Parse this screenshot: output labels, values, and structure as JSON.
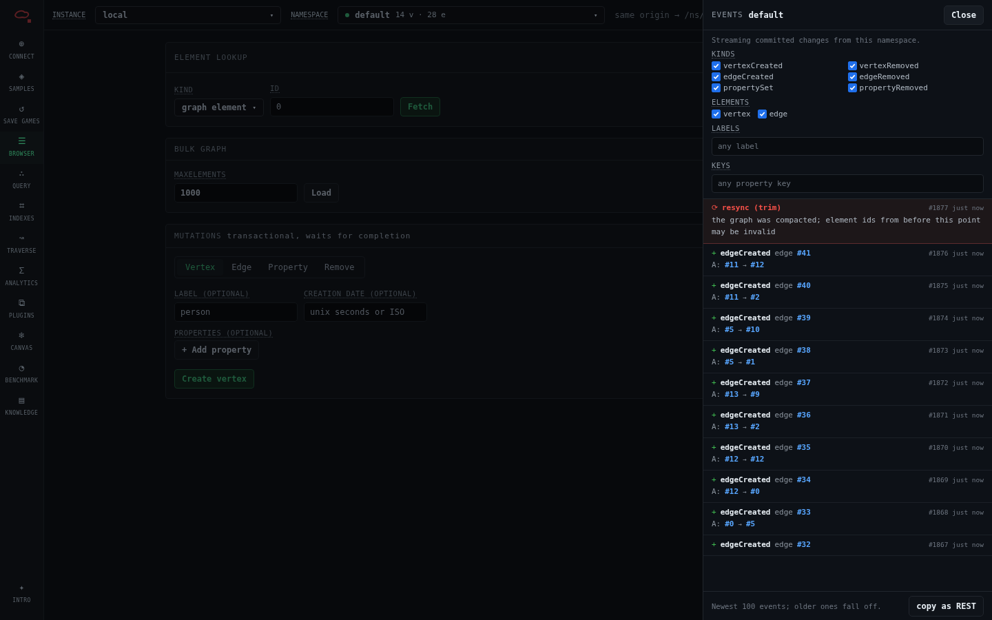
{
  "sidebar": {
    "items": [
      {
        "icon": "⊕",
        "label": "CONNECT",
        "selected": false
      },
      {
        "icon": "◈",
        "label": "SAMPLES",
        "selected": false
      },
      {
        "icon": "↺",
        "label": "SAVE GAMES",
        "selected": false
      },
      {
        "icon": "☰",
        "label": "BROWSER",
        "selected": true
      },
      {
        "icon": "∴",
        "label": "QUERY",
        "selected": false
      },
      {
        "icon": "⌗",
        "label": "INDEXES",
        "selected": false
      },
      {
        "icon": "↝",
        "label": "TRAVERSE",
        "selected": false
      },
      {
        "icon": "Σ",
        "label": "ANALYTICS",
        "selected": false
      },
      {
        "icon": "⧉",
        "label": "PLUGINS",
        "selected": false
      },
      {
        "icon": "❄",
        "label": "CANVAS",
        "selected": false
      },
      {
        "icon": "◔",
        "label": "BENCHMARK",
        "selected": false
      },
      {
        "icon": "▤",
        "label": "KNOWLEDGE",
        "selected": false
      }
    ],
    "footer": {
      "icon": "✦",
      "label": "INTRO"
    }
  },
  "topbar": {
    "instance_label": "INSTANCE",
    "instance": "local",
    "namespace_label": "NAMESPACE",
    "namespace": "default",
    "namespace_stats": "14 v · 28 e",
    "caret": "▾",
    "endpoint": "same origin → /ns/"
  },
  "lookup": {
    "title": "ELEMENT LOOKUP",
    "kind_label": "KIND",
    "kind": "graph element",
    "id_label": "ID",
    "id_placeholder": "0",
    "button": "Fetch"
  },
  "bulk": {
    "title": "BULK GRAPH",
    "max_label": "MAXELEMENTS",
    "max_value": "1000",
    "button": "Load"
  },
  "mutations": {
    "title": "MUTATIONS",
    "subtitle": "transactional, waits for completion",
    "tabs": [
      {
        "label": "Vertex",
        "selected": true
      },
      {
        "label": "Edge",
        "selected": false
      },
      {
        "label": "Property",
        "selected": false
      },
      {
        "label": "Remove",
        "selected": false
      }
    ],
    "label_label": "LABEL (OPTIONAL)",
    "label_placeholder": "person",
    "date_label": "CREATION DATE (OPTIONAL)",
    "date_placeholder": "unix seconds or ISO",
    "properties_label": "PROPERTIES (OPTIONAL)",
    "add_button": "+ Add property",
    "create_button": "Create vertex"
  },
  "drawer": {
    "title": "EVENTS",
    "namespace": "default",
    "close": "Close",
    "intro": "Streaming committed changes from this namespace.",
    "kinds_label": "KINDS",
    "kinds": [
      {
        "label": "vertexCreated",
        "checked": true
      },
      {
        "label": "vertexRemoved",
        "checked": true
      },
      {
        "label": "edgeCreated",
        "checked": true
      },
      {
        "label": "edgeRemoved",
        "checked": true
      },
      {
        "label": "propertySet",
        "checked": true
      },
      {
        "label": "propertyRemoved",
        "checked": true
      }
    ],
    "elements_label": "ELEMENTS",
    "elements": [
      {
        "label": "vertex",
        "checked": true
      },
      {
        "label": "edge",
        "checked": true
      }
    ],
    "labels_label": "LABELS",
    "labels_placeholder": "any label",
    "keys_label": "KEYS",
    "keys_placeholder": "any property key",
    "events": [
      {
        "kind": "resync",
        "icon": "⟳",
        "title": "resync (trim)",
        "seq": "#1877",
        "time": "just now",
        "message": "the graph was compacted; element ids from before this point may be invalid"
      },
      {
        "kind": "change",
        "sign": "+",
        "type": "edgeCreated",
        "element": "edge",
        "id": "#41",
        "seq": "#1876",
        "time": "just now",
        "prop": "A:",
        "from": "#11",
        "arrow": "→",
        "to": "#12"
      },
      {
        "kind": "change",
        "sign": "+",
        "type": "edgeCreated",
        "element": "edge",
        "id": "#40",
        "seq": "#1875",
        "time": "just now",
        "prop": "A:",
        "from": "#11",
        "arrow": "→",
        "to": "#2"
      },
      {
        "kind": "change",
        "sign": "+",
        "type": "edgeCreated",
        "element": "edge",
        "id": "#39",
        "seq": "#1874",
        "time": "just now",
        "prop": "A:",
        "from": "#5",
        "arrow": "→",
        "to": "#10"
      },
      {
        "kind": "change",
        "sign": "+",
        "type": "edgeCreated",
        "element": "edge",
        "id": "#38",
        "seq": "#1873",
        "time": "just now",
        "prop": "A:",
        "from": "#5",
        "arrow": "→",
        "to": "#1"
      },
      {
        "kind": "change",
        "sign": "+",
        "type": "edgeCreated",
        "element": "edge",
        "id": "#37",
        "seq": "#1872",
        "time": "just now",
        "prop": "A:",
        "from": "#13",
        "arrow": "→",
        "to": "#9"
      },
      {
        "kind": "change",
        "sign": "+",
        "type": "edgeCreated",
        "element": "edge",
        "id": "#36",
        "seq": "#1871",
        "time": "just now",
        "prop": "A:",
        "from": "#13",
        "arrow": "→",
        "to": "#2"
      },
      {
        "kind": "change",
        "sign": "+",
        "type": "edgeCreated",
        "element": "edge",
        "id": "#35",
        "seq": "#1870",
        "time": "just now",
        "prop": "A:",
        "from": "#12",
        "arrow": "→",
        "to": "#12"
      },
      {
        "kind": "change",
        "sign": "+",
        "type": "edgeCreated",
        "element": "edge",
        "id": "#34",
        "seq": "#1869",
        "time": "just now",
        "prop": "A:",
        "from": "#12",
        "arrow": "→",
        "to": "#0"
      },
      {
        "kind": "change",
        "sign": "+",
        "type": "edgeCreated",
        "element": "edge",
        "id": "#33",
        "seq": "#1868",
        "time": "just now",
        "prop": "A:",
        "from": "#0",
        "arrow": "→",
        "to": "#5"
      },
      {
        "kind": "change",
        "sign": "+",
        "type": "edgeCreated",
        "element": "edge",
        "id": "#32",
        "seq": "#1867",
        "time": "just now"
      }
    ],
    "footer": "Newest 100 events; older ones fall off.",
    "copy": "copy as REST"
  }
}
